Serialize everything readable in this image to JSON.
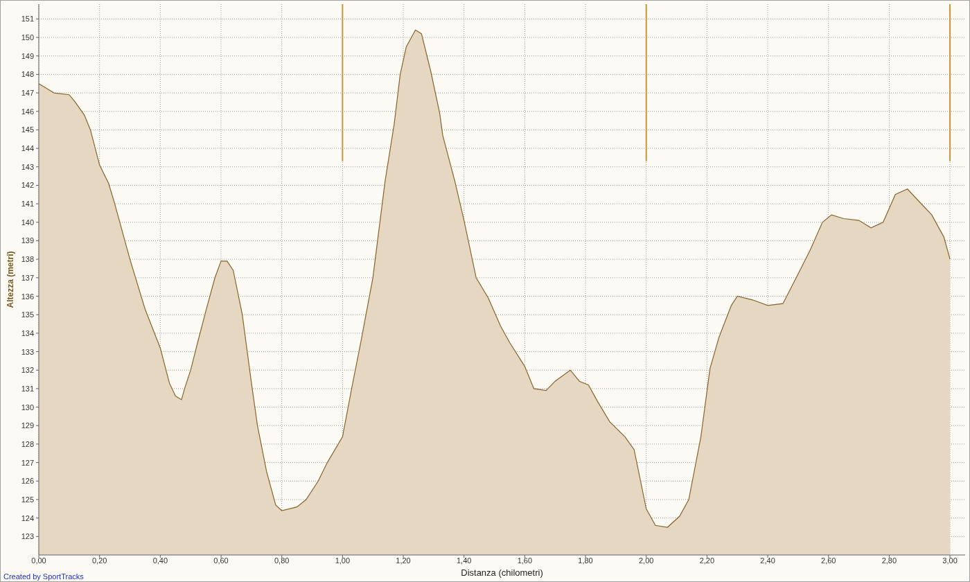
{
  "chart": {
    "chart_data": {
      "type": "area",
      "xlabel": "Distanza (chilometri)",
      "ylabel": "Altezza (metri)",
      "x": [
        0,
        0.03,
        0.05,
        0.1,
        0.12,
        0.15,
        0.17,
        0.2,
        0.23,
        0.25,
        0.3,
        0.35,
        0.4,
        0.43,
        0.45,
        0.47,
        0.48,
        0.5,
        0.52,
        0.55,
        0.58,
        0.6,
        0.62,
        0.64,
        0.67,
        0.7,
        0.72,
        0.75,
        0.78,
        0.8,
        0.85,
        0.88,
        0.92,
        0.95,
        1.0,
        1.03,
        1.06,
        1.1,
        1.14,
        1.17,
        1.19,
        1.21,
        1.24,
        1.26,
        1.29,
        1.32,
        1.33,
        1.37,
        1.4,
        1.44,
        1.48,
        1.52,
        1.55,
        1.6,
        1.63,
        1.67,
        1.7,
        1.75,
        1.78,
        1.81,
        1.84,
        1.88,
        1.93,
        1.96,
        2.0,
        2.03,
        2.07,
        2.11,
        2.14,
        2.18,
        2.21,
        2.24,
        2.28,
        2.3,
        2.35,
        2.4,
        2.45,
        2.5,
        2.54,
        2.58,
        2.61,
        2.65,
        2.7,
        2.74,
        2.78,
        2.82,
        2.86,
        2.9,
        2.94,
        2.98,
        3.0
      ],
      "series": [
        {
          "color": "#e6d7c2",
          "values": [
            147.5,
            147.2,
            147.0,
            146.9,
            146.5,
            145.8,
            145.0,
            143.1,
            142.1,
            141.0,
            138.0,
            135.3,
            133.2,
            131.3,
            130.6,
            130.4,
            131.0,
            132.0,
            133.3,
            135.2,
            137.0,
            137.9,
            137.9,
            137.4,
            135.0,
            131.3,
            129.0,
            126.5,
            124.7,
            124.4,
            124.6,
            125.0,
            126.0,
            127.0,
            128.4,
            131.0,
            133.5,
            137.0,
            142.2,
            145.3,
            148.0,
            149.5,
            150.4,
            150.2,
            148.2,
            145.9,
            144.7,
            142.2,
            140.1,
            137.0,
            135.9,
            134.4,
            133.5,
            132.2,
            131.0,
            130.9,
            131.4,
            132.0,
            131.4,
            131.2,
            130.3,
            129.2,
            128.4,
            127.7,
            124.5,
            123.6,
            123.5,
            124.1,
            125.0,
            128.4,
            132.1,
            133.8,
            135.5,
            136.0,
            135.8,
            135.5,
            135.6,
            137.2,
            138.5,
            140.0,
            140.4,
            140.2,
            140.1,
            139.7,
            140.0,
            141.5,
            141.8,
            141.1,
            140.4,
            139.2,
            138.0
          ]
        }
      ],
      "xlim": [
        0,
        3.05
      ],
      "ylim": [
        122,
        151.8
      ],
      "xticks": [
        {
          "value": 0,
          "label": "0,00"
        },
        {
          "value": 0.2,
          "label": "0,20"
        },
        {
          "value": 0.4,
          "label": "0,40"
        },
        {
          "value": 0.6,
          "label": "0,60"
        },
        {
          "value": 0.8,
          "label": "0,80"
        },
        {
          "value": 1.0,
          "label": "1,00"
        },
        {
          "value": 1.2,
          "label": "1,20"
        },
        {
          "value": 1.4,
          "label": "1,40"
        },
        {
          "value": 1.6,
          "label": "1,60"
        },
        {
          "value": 1.8,
          "label": "1,80"
        },
        {
          "value": 2.0,
          "label": "2,00"
        },
        {
          "value": 2.2,
          "label": "2,20"
        },
        {
          "value": 2.4,
          "label": "2,40"
        },
        {
          "value": 2.6,
          "label": "2,60"
        },
        {
          "value": 2.8,
          "label": "2,80"
        },
        {
          "value": 3.0,
          "label": "3,00"
        }
      ],
      "yticks": [
        123,
        124,
        125,
        126,
        127,
        128,
        129,
        130,
        131,
        132,
        133,
        134,
        135,
        136,
        137,
        138,
        139,
        140,
        141,
        142,
        143,
        144,
        145,
        146,
        147,
        148,
        149,
        150,
        151
      ],
      "grid": true,
      "ref_lines": [
        {
          "axis": "x",
          "value": 1.0
        },
        {
          "axis": "x",
          "value": 2.0
        },
        {
          "axis": "x",
          "value": 3.0
        }
      ]
    }
  },
  "footer": {
    "credit": "Created by SportTracks"
  }
}
